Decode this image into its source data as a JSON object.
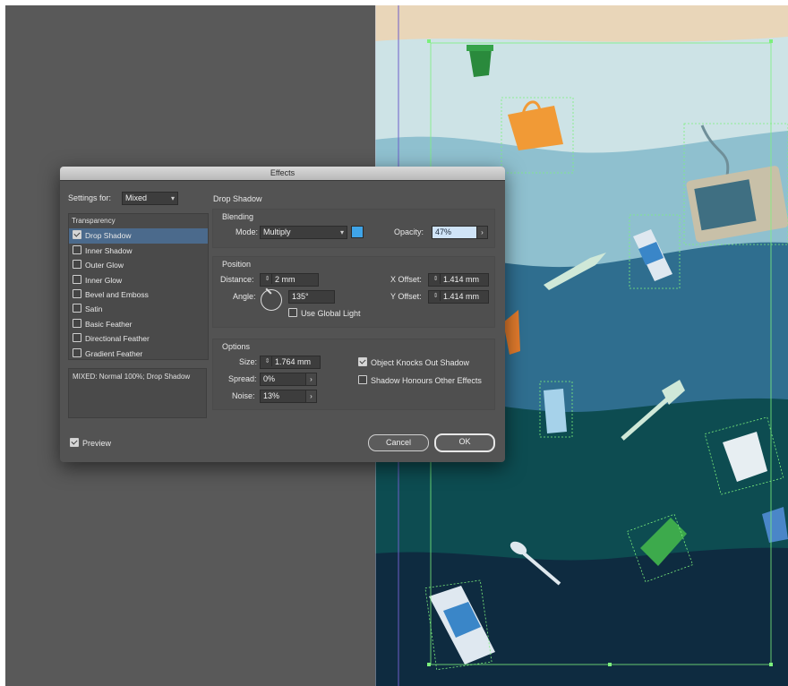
{
  "dialog": {
    "title": "Effects",
    "settings_for_label": "Settings for:",
    "settings_for_value": "Mixed",
    "list_header": "Transparency",
    "effects": [
      {
        "label": "Drop Shadow",
        "checked": true,
        "selected": true
      },
      {
        "label": "Inner Shadow",
        "checked": false
      },
      {
        "label": "Outer Glow",
        "checked": false
      },
      {
        "label": "Inner Glow",
        "checked": false
      },
      {
        "label": "Bevel and Emboss",
        "checked": false
      },
      {
        "label": "Satin",
        "checked": false
      },
      {
        "label": "Basic Feather",
        "checked": false
      },
      {
        "label": "Directional Feather",
        "checked": false
      },
      {
        "label": "Gradient Feather",
        "checked": false
      }
    ],
    "summary": "MIXED: Normal 100%; Drop Shadow",
    "preview_label": "Preview",
    "section_title": "Drop Shadow",
    "blending": {
      "title": "Blending",
      "mode_label": "Mode:",
      "mode_value": "Multiply",
      "opacity_label": "Opacity:",
      "opacity_value": "47%",
      "color": "#3fa4e8"
    },
    "position": {
      "title": "Position",
      "distance_label": "Distance:",
      "distance_value": "2 mm",
      "angle_label": "Angle:",
      "angle_value": "135°",
      "use_global_light_label": "Use Global Light",
      "x_offset_label": "X Offset:",
      "x_offset_value": "1.414 mm",
      "y_offset_label": "Y Offset:",
      "y_offset_value": "1.414 mm"
    },
    "options": {
      "title": "Options",
      "size_label": "Size:",
      "size_value": "1.764 mm",
      "spread_label": "Spread:",
      "spread_value": "0%",
      "noise_label": "Noise:",
      "noise_value": "13%",
      "knocks_out_label": "Object Knocks Out Shadow",
      "honours_label": "Shadow Honours Other Effects"
    },
    "cancel_label": "Cancel",
    "ok_label": "OK"
  },
  "colors": {
    "workspace": "#595959",
    "sand": "#e9d6b9",
    "water_1": "#cde3e6",
    "water_2": "#8fc0cf",
    "water_3": "#2f6e8f",
    "water_4": "#0d4c51",
    "water_5": "#0e2b40",
    "selection": "#7cf07c"
  }
}
